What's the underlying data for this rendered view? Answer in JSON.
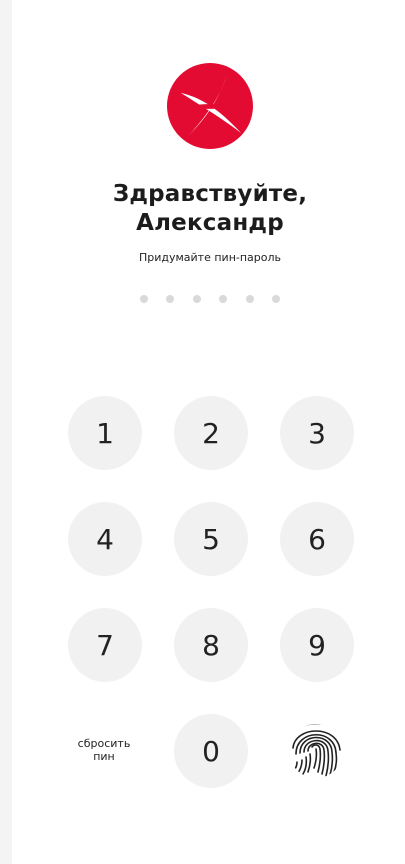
{
  "greeting": {
    "line1": "Здравствуйте,",
    "line2": "Александр"
  },
  "prompt": "Придумайте пин-пароль",
  "pin": {
    "length": 6,
    "entered": 0
  },
  "keypad": {
    "k1": "1",
    "k2": "2",
    "k3": "3",
    "k4": "4",
    "k5": "5",
    "k6": "6",
    "k7": "7",
    "k8": "8",
    "k9": "9",
    "k0": "0",
    "reset_line1": "сбросить",
    "reset_line2": "пин"
  },
  "icons": {
    "logo": "brand-logo-icon",
    "biometric": "fingerprint-icon"
  },
  "colors": {
    "brand": "#e30b32",
    "key_bg": "#f1f1f1",
    "dot": "#d9d9d9",
    "text": "#1c1c1c"
  }
}
